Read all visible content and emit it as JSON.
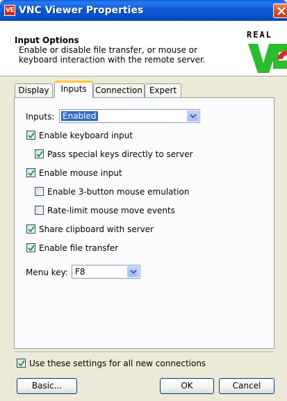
{
  "window": {
    "title": "VNC Viewer Properties",
    "app_icon_text": "VE"
  },
  "header": {
    "title": "Input Options",
    "description": "Enable or disable file transfer, or mouse or keyboard interaction with the remote server.",
    "logo_text": "REAL"
  },
  "tabs": [
    {
      "label": "Display",
      "active": false
    },
    {
      "label": "Inputs",
      "active": true
    },
    {
      "label": "Connection",
      "active": false
    },
    {
      "label": "Expert",
      "active": false
    }
  ],
  "inputs": {
    "label": "Inputs:",
    "selected": "Enabled"
  },
  "options": [
    {
      "label": "Enable keyboard input",
      "checked": true
    },
    {
      "label": "Pass special keys directly to server",
      "checked": true
    },
    {
      "label": "Enable mouse input",
      "checked": true
    },
    {
      "label": "Enable 3-button mouse emulation",
      "checked": false
    },
    {
      "label": "Rate-limit mouse move events",
      "checked": false
    },
    {
      "label": "Share clipboard with server",
      "checked": true
    },
    {
      "label": "Enable file transfer",
      "checked": true
    }
  ],
  "menu_key": {
    "label": "Menu key:",
    "selected": "F8"
  },
  "footer": {
    "all_connections_label": "Use these settings for all new connections",
    "all_connections_checked": true,
    "basic_label": "Basic...",
    "ok_label": "OK",
    "cancel_label": "Cancel"
  },
  "colors": {
    "titlebar": "#0a5fd8",
    "logo_green": "#2ebb2e",
    "logo_red": "#e3262a",
    "active_tab_accent": "#ffc83c",
    "selection": "#316ac5",
    "check": "#21a121"
  },
  "icons": {
    "close": "close-icon",
    "dropdown": "chevron-down-icon",
    "check": "checkmark-icon"
  }
}
